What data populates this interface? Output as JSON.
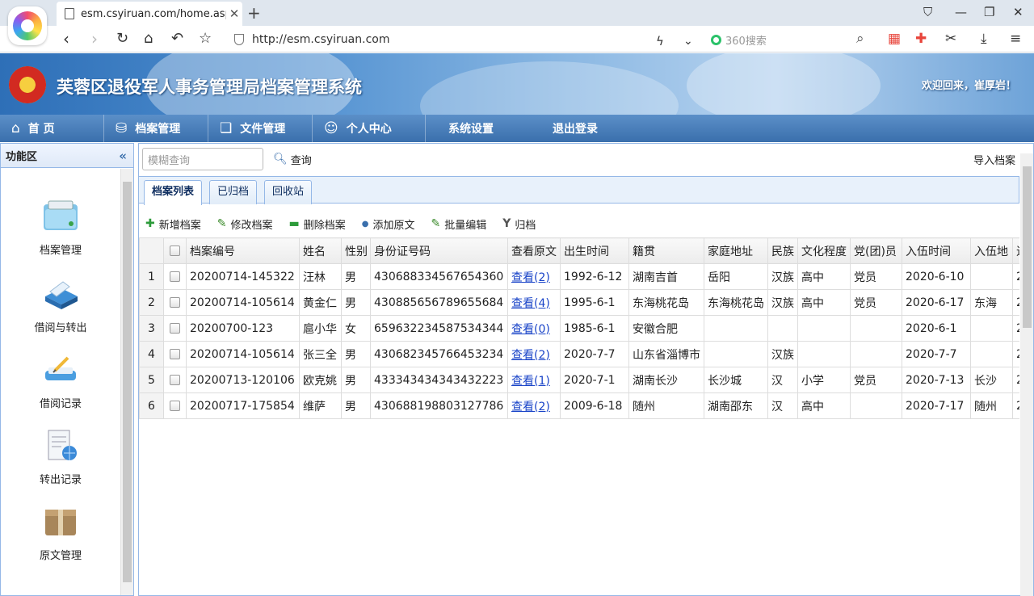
{
  "browser": {
    "tab_title": "esm.csyiruan.com/home.aspx",
    "url": "http://esm.csyiruan.com",
    "search_engine": "360搜索"
  },
  "header": {
    "system_name": "芙蓉区退役军人事务管理局档案管理系统",
    "welcome": "欢迎回来，崔厚岩！"
  },
  "nav": {
    "items": [
      {
        "label": "首 页",
        "icon": "home-icon"
      },
      {
        "label": "档案管理",
        "icon": "archive-icon"
      },
      {
        "label": "文件管理",
        "icon": "documents-icon"
      },
      {
        "label": "个人中心",
        "icon": "user-icon"
      },
      {
        "label": "系统设置",
        "icon": ""
      },
      {
        "label": "退出登录",
        "icon": ""
      }
    ]
  },
  "sidebar": {
    "title": "功能区",
    "items": [
      {
        "label": "档案管理",
        "icon": "folder-icon"
      },
      {
        "label": "借阅与转出",
        "icon": "scanner-icon"
      },
      {
        "label": "借阅记录",
        "icon": "pen-tray-icon"
      },
      {
        "label": "转出记录",
        "icon": "globe-document-icon"
      },
      {
        "label": "原文管理",
        "icon": "box-icon"
      }
    ]
  },
  "search": {
    "placeholder": "模糊查询",
    "button": "查询"
  },
  "import_label": "导入档案",
  "tabs": [
    "档案列表",
    "已归档",
    "回收站"
  ],
  "toolbar": {
    "add": "新增档案",
    "edit": "修改档案",
    "delete": "删除档案",
    "add_original": "添加原文",
    "batch_edit": "批量编辑",
    "archive": "归档"
  },
  "table": {
    "columns": [
      "档案编号",
      "姓名",
      "性别",
      "身份证号码",
      "查看原文",
      "出生时间",
      "籍贯",
      "家庭地址",
      "民族",
      "文化程度",
      "党(团)员",
      "入伍时间",
      "入伍地",
      "退"
    ],
    "rows": [
      {
        "n": "1",
        "id": "20200714-145322",
        "name": "汪林",
        "sex": "男",
        "idcard": "430688334567654360",
        "view": "查看(2)",
        "birth": "1992-6-12",
        "origin": "湖南吉首",
        "home": "岳阳",
        "ethnic": "汉族",
        "edu": "高中",
        "party": "党员",
        "enlist": "2020-6-10",
        "place": "",
        "extra": "2"
      },
      {
        "n": "2",
        "id": "20200714-105614",
        "name": "黄金仁",
        "sex": "男",
        "idcard": "430885656789655684",
        "view": "查看(4)",
        "birth": "1995-6-1",
        "origin": "东海桃花岛",
        "home": "东海桃花岛",
        "ethnic": "汉族",
        "edu": "高中",
        "party": "党员",
        "enlist": "2020-6-17",
        "place": "东海",
        "extra": "2"
      },
      {
        "n": "3",
        "id": "20200700-123",
        "name": "扈小华",
        "sex": "女",
        "idcard": "659632234587534344",
        "view": "查看(0)",
        "birth": "1985-6-1",
        "origin": "安徽合肥",
        "home": "",
        "ethnic": "",
        "edu": "",
        "party": "",
        "enlist": "2020-6-1",
        "place": "",
        "extra": "2"
      },
      {
        "n": "4",
        "id": "20200714-105614",
        "name": "张三全",
        "sex": "男",
        "idcard": "430682345766453234",
        "view": "查看(2)",
        "birth": "2020-7-7",
        "origin": "山东省淄博市",
        "home": "",
        "ethnic": "汉族",
        "edu": "",
        "party": "",
        "enlist": "2020-7-7",
        "place": "",
        "extra": "2"
      },
      {
        "n": "5",
        "id": "20200713-120106",
        "name": "欧克姚",
        "sex": "男",
        "idcard": "433343434343432223",
        "view": "查看(1)",
        "birth": "2020-7-1",
        "origin": "湖南长沙",
        "home": "长沙城",
        "ethnic": "汉",
        "edu": "小学",
        "party": "党员",
        "enlist": "2020-7-13",
        "place": "长沙",
        "extra": "2"
      },
      {
        "n": "6",
        "id": "20200717-175854",
        "name": "维萨",
        "sex": "男",
        "idcard": "430688198803127786",
        "view": "查看(2)",
        "birth": "2009-6-18",
        "origin": "随州",
        "home": "湖南邵东",
        "ethnic": "汉",
        "edu": "高中",
        "party": "",
        "enlist": "2020-7-17",
        "place": "随州",
        "extra": "2"
      }
    ]
  },
  "colors": {
    "accent": "#3a6fac",
    "border": "#95b8e7",
    "link": "#1a44c8"
  }
}
